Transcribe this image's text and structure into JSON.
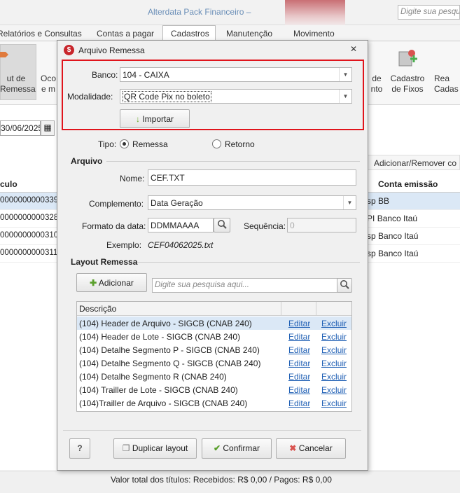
{
  "app": {
    "title": "Alterdata Pack Financeiro –",
    "search_placeholder": "Digite sua pesquisa"
  },
  "menu": {
    "items": [
      "Relatórios e Consultas",
      "Contas a pagar",
      "Cadastros",
      "Manutenção",
      "Movimento"
    ],
    "active": "Cadastros"
  },
  "ribbon": {
    "left_label": "ut de\nRemessa",
    "left2_label": "Oco\ne m",
    "right": [
      {
        "label": "de\nnto"
      },
      {
        "label": "Cadastro\nde Fixos"
      },
      {
        "label": "Rea\nCadas"
      }
    ]
  },
  "background": {
    "date_value": "30/06/2025",
    "left_header": "culo",
    "left_rows": [
      "0000000000339",
      "0000000000328",
      "0000000000310",
      "0000000000311"
    ],
    "add_remove_label": "Adicionar/Remover co",
    "right_header": "Conta emissão",
    "right_rows": [
      {
        "prefix": "sp",
        "value": "BB"
      },
      {
        "prefix": "PI",
        "value": "Banco Itaú"
      },
      {
        "prefix": "sp",
        "value": "Banco Itaú"
      },
      {
        "prefix": "sp",
        "value": "Banco Itaú"
      }
    ],
    "status": "Valor total dos títulos: Recebidos: R$ 0,00 / Pagos: R$ 0,00"
  },
  "dialog": {
    "title": "Arquivo Remessa",
    "banco_label": "Banco:",
    "banco_value": "104 - CAIXA",
    "modalidade_label": "Modalidade:",
    "modalidade_value": "QR Code Pix no boleto",
    "importar_label": "Importar",
    "tipo_label": "Tipo:",
    "tipo_options": [
      "Remessa",
      "Retorno"
    ],
    "tipo_selected": "Remessa",
    "arquivo_section": "Arquivo",
    "nome_label": "Nome:",
    "nome_value": "CEF.TXT",
    "complemento_label": "Complemento:",
    "complemento_value": "Data Geração",
    "formato_label": "Formato da data:",
    "formato_value": "DDMMAAAA",
    "sequencia_label": "Sequência:",
    "sequencia_value": "0",
    "exemplo_label": "Exemplo:",
    "exemplo_value": "CEF04062025.txt",
    "layout_section": "Layout Remessa",
    "adicionar_label": "Adicionar",
    "search_placeholder": "Digite sua pesquisa aqui...",
    "grid_header": "Descrição",
    "edit_label": "Editar",
    "delete_label": "Excluir",
    "rows": [
      "(104) Header de Arquivo - SIGCB (CNAB 240)",
      "(104) Header de Lote - SIGCB (CNAB 240)",
      "(104) Detalhe Segmento P - SIGCB (CNAB 240)",
      "(104) Detalhe Segmento Q - SIGCB (CNAB 240)",
      "(104) Detalhe Segmento R (CNAB 240)",
      "(104) Trailler de Lote - SIGCB (CNAB 240)",
      "(104)Trailler de Arquivo - SIGCB (CNAB 240)"
    ],
    "help_label": "?",
    "duplicar_label": "Duplicar layout",
    "confirmar_label": "Confirmar",
    "cancelar_label": "Cancelar"
  },
  "colors": {
    "highlight": "#e0141c",
    "link": "#1f5fb4",
    "selected_row": "#dbe8f6"
  }
}
